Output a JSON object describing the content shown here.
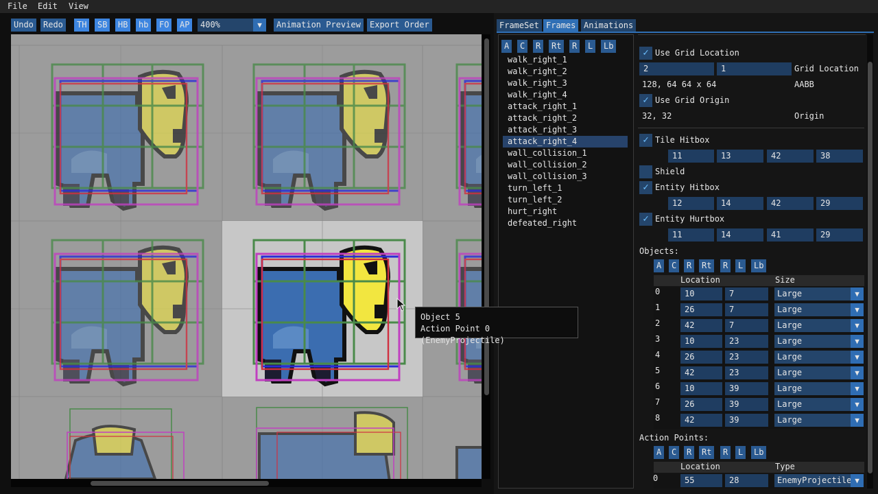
{
  "menu": [
    "File",
    "Edit",
    "View"
  ],
  "toolbar": {
    "undo": "Undo",
    "redo": "Redo",
    "toggles": [
      "TH",
      "SB",
      "HB",
      "hb",
      "FO",
      "AP"
    ],
    "zoom": "400%",
    "animation_preview": "Animation Preview",
    "export_order": "Export Order"
  },
  "tabs": [
    "FrameSet",
    "Frames",
    "Animations"
  ],
  "frames_toolbar": [
    "A",
    "C",
    "R",
    "Rt",
    "R",
    "L",
    "Lb"
  ],
  "frames": [
    "walk_right_1",
    "walk_right_2",
    "walk_right_3",
    "walk_right_4",
    "attack_right_1",
    "attack_right_2",
    "attack_right_3",
    "attack_right_4",
    "wall_collision_1",
    "wall_collision_2",
    "wall_collision_3",
    "turn_left_1",
    "turn_left_2",
    "hurt_right",
    "defeated_right"
  ],
  "selected_frame": "attack_right_4",
  "props": {
    "use_grid_location": "Use Grid Location",
    "grid_x": "2",
    "grid_y": "1",
    "grid_location_label": "Grid Location",
    "aabb_value": "128, 64  64 x 64",
    "aabb_label": "AABB",
    "use_grid_origin": "Use Grid Origin",
    "origin_value": "32, 32",
    "origin_label": "Origin",
    "tile_hitbox": "Tile Hitbox",
    "tile_hitbox_values": [
      "11",
      "13",
      "42",
      "38"
    ],
    "shield": "Shield",
    "entity_hitbox": "Entity Hitbox",
    "entity_hitbox_values": [
      "12",
      "14",
      "42",
      "29"
    ],
    "entity_hurtbox": "Entity Hurtbox",
    "entity_hurtbox_values": [
      "11",
      "14",
      "41",
      "29"
    ]
  },
  "objects": {
    "title": "Objects:",
    "headers": [
      "Location",
      "Size"
    ],
    "rows": [
      {
        "index": "0",
        "x": "10",
        "y": "7",
        "size": "Large"
      },
      {
        "index": "1",
        "x": "26",
        "y": "7",
        "size": "Large"
      },
      {
        "index": "2",
        "x": "42",
        "y": "7",
        "size": "Large"
      },
      {
        "index": "3",
        "x": "10",
        "y": "23",
        "size": "Large"
      },
      {
        "index": "4",
        "x": "26",
        "y": "23",
        "size": "Large"
      },
      {
        "index": "5",
        "x": "42",
        "y": "23",
        "size": "Large"
      },
      {
        "index": "6",
        "x": "10",
        "y": "39",
        "size": "Large"
      },
      {
        "index": "7",
        "x": "26",
        "y": "39",
        "size": "Large"
      },
      {
        "index": "8",
        "x": "42",
        "y": "39",
        "size": "Large"
      }
    ]
  },
  "action_points": {
    "title": "Action Points:",
    "headers": [
      "Location",
      "Type"
    ],
    "rows": [
      {
        "index": "0",
        "x": "55",
        "y": "28",
        "type": "EnemyProjectile"
      }
    ]
  },
  "tooltip": {
    "line1": "Object 5",
    "line2": "Action Point 0 (EnemyProjectile)"
  },
  "colors": {
    "button": "#2a5a91",
    "toggle_active": "#3d85e0",
    "field": "#1f3d61",
    "tile_hitbox": "#4a8a4a",
    "entity_hitbox": "#2b2bd6",
    "entity_hurtbox": "#c040c0",
    "sprite_body": "#3b6db0",
    "sprite_head": "#f2e640"
  }
}
